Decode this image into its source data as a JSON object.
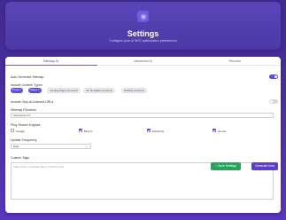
{
  "header": {
    "title": "Settings",
    "subtitle": "Configure your AI SEO optimization preferences"
  },
  "tabs": [
    {
      "label": "Sitemap XL",
      "active": true
    },
    {
      "label": "Interactive AI",
      "active": false
    },
    {
      "label": "Records",
      "active": false
    }
  ],
  "auto_generate": {
    "label": "Auto Generate Sitemap",
    "enabled": true
  },
  "content_types": {
    "label": "Include Content Types",
    "items": [
      {
        "label": "Posts ×",
        "selected": true
      },
      {
        "label": "Pages ×",
        "selected": true
      },
      {
        "label": "Landing Pages (Custom)",
        "selected": false
      },
      {
        "label": "Ab Templates (Custom)",
        "selected": false
      },
      {
        "label": "Portfolio (Custom)",
        "selected": false
      }
    ]
  },
  "include_only_indexed": {
    "label": "Include Only AI-Indexed URLs",
    "enabled": false
  },
  "filename": {
    "label": "Sitemap Filename",
    "value": "sitemap-ai.xml"
  },
  "ping_engines": {
    "label": "Ping Search Engines",
    "items": [
      {
        "label": "Google",
        "checked": false
      },
      {
        "label": "Bing AI",
        "checked": true
      },
      {
        "label": "Perplexity",
        "checked": true
      },
      {
        "label": "Gemini",
        "checked": true
      }
    ]
  },
  "update_frequency": {
    "label": "Update Frequency",
    "value": "Daily"
  },
  "custom_tags": {
    "label": "Custom Tags",
    "placeholder": "Add custom metadata tags in JSON format..."
  },
  "buttons": {
    "save": "Save Settings",
    "generate": "Generate Now"
  },
  "colors": {
    "accent": "#5b4ee0",
    "save": "#27a35a",
    "generate": "#5b3fc9"
  }
}
